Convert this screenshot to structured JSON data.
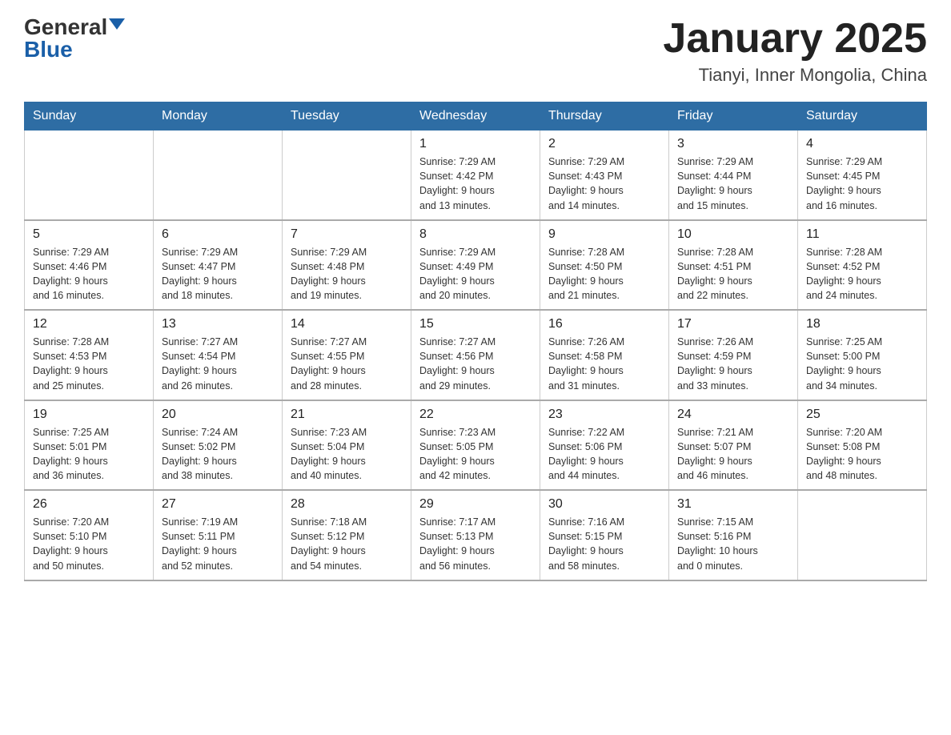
{
  "logo": {
    "general": "General",
    "blue": "Blue"
  },
  "title": "January 2025",
  "location": "Tianyi, Inner Mongolia, China",
  "weekdays": [
    "Sunday",
    "Monday",
    "Tuesday",
    "Wednesday",
    "Thursday",
    "Friday",
    "Saturday"
  ],
  "weeks": [
    [
      {
        "day": "",
        "info": ""
      },
      {
        "day": "",
        "info": ""
      },
      {
        "day": "",
        "info": ""
      },
      {
        "day": "1",
        "info": "Sunrise: 7:29 AM\nSunset: 4:42 PM\nDaylight: 9 hours\nand 13 minutes."
      },
      {
        "day": "2",
        "info": "Sunrise: 7:29 AM\nSunset: 4:43 PM\nDaylight: 9 hours\nand 14 minutes."
      },
      {
        "day": "3",
        "info": "Sunrise: 7:29 AM\nSunset: 4:44 PM\nDaylight: 9 hours\nand 15 minutes."
      },
      {
        "day": "4",
        "info": "Sunrise: 7:29 AM\nSunset: 4:45 PM\nDaylight: 9 hours\nand 16 minutes."
      }
    ],
    [
      {
        "day": "5",
        "info": "Sunrise: 7:29 AM\nSunset: 4:46 PM\nDaylight: 9 hours\nand 16 minutes."
      },
      {
        "day": "6",
        "info": "Sunrise: 7:29 AM\nSunset: 4:47 PM\nDaylight: 9 hours\nand 18 minutes."
      },
      {
        "day": "7",
        "info": "Sunrise: 7:29 AM\nSunset: 4:48 PM\nDaylight: 9 hours\nand 19 minutes."
      },
      {
        "day": "8",
        "info": "Sunrise: 7:29 AM\nSunset: 4:49 PM\nDaylight: 9 hours\nand 20 minutes."
      },
      {
        "day": "9",
        "info": "Sunrise: 7:28 AM\nSunset: 4:50 PM\nDaylight: 9 hours\nand 21 minutes."
      },
      {
        "day": "10",
        "info": "Sunrise: 7:28 AM\nSunset: 4:51 PM\nDaylight: 9 hours\nand 22 minutes."
      },
      {
        "day": "11",
        "info": "Sunrise: 7:28 AM\nSunset: 4:52 PM\nDaylight: 9 hours\nand 24 minutes."
      }
    ],
    [
      {
        "day": "12",
        "info": "Sunrise: 7:28 AM\nSunset: 4:53 PM\nDaylight: 9 hours\nand 25 minutes."
      },
      {
        "day": "13",
        "info": "Sunrise: 7:27 AM\nSunset: 4:54 PM\nDaylight: 9 hours\nand 26 minutes."
      },
      {
        "day": "14",
        "info": "Sunrise: 7:27 AM\nSunset: 4:55 PM\nDaylight: 9 hours\nand 28 minutes."
      },
      {
        "day": "15",
        "info": "Sunrise: 7:27 AM\nSunset: 4:56 PM\nDaylight: 9 hours\nand 29 minutes."
      },
      {
        "day": "16",
        "info": "Sunrise: 7:26 AM\nSunset: 4:58 PM\nDaylight: 9 hours\nand 31 minutes."
      },
      {
        "day": "17",
        "info": "Sunrise: 7:26 AM\nSunset: 4:59 PM\nDaylight: 9 hours\nand 33 minutes."
      },
      {
        "day": "18",
        "info": "Sunrise: 7:25 AM\nSunset: 5:00 PM\nDaylight: 9 hours\nand 34 minutes."
      }
    ],
    [
      {
        "day": "19",
        "info": "Sunrise: 7:25 AM\nSunset: 5:01 PM\nDaylight: 9 hours\nand 36 minutes."
      },
      {
        "day": "20",
        "info": "Sunrise: 7:24 AM\nSunset: 5:02 PM\nDaylight: 9 hours\nand 38 minutes."
      },
      {
        "day": "21",
        "info": "Sunrise: 7:23 AM\nSunset: 5:04 PM\nDaylight: 9 hours\nand 40 minutes."
      },
      {
        "day": "22",
        "info": "Sunrise: 7:23 AM\nSunset: 5:05 PM\nDaylight: 9 hours\nand 42 minutes."
      },
      {
        "day": "23",
        "info": "Sunrise: 7:22 AM\nSunset: 5:06 PM\nDaylight: 9 hours\nand 44 minutes."
      },
      {
        "day": "24",
        "info": "Sunrise: 7:21 AM\nSunset: 5:07 PM\nDaylight: 9 hours\nand 46 minutes."
      },
      {
        "day": "25",
        "info": "Sunrise: 7:20 AM\nSunset: 5:08 PM\nDaylight: 9 hours\nand 48 minutes."
      }
    ],
    [
      {
        "day": "26",
        "info": "Sunrise: 7:20 AM\nSunset: 5:10 PM\nDaylight: 9 hours\nand 50 minutes."
      },
      {
        "day": "27",
        "info": "Sunrise: 7:19 AM\nSunset: 5:11 PM\nDaylight: 9 hours\nand 52 minutes."
      },
      {
        "day": "28",
        "info": "Sunrise: 7:18 AM\nSunset: 5:12 PM\nDaylight: 9 hours\nand 54 minutes."
      },
      {
        "day": "29",
        "info": "Sunrise: 7:17 AM\nSunset: 5:13 PM\nDaylight: 9 hours\nand 56 minutes."
      },
      {
        "day": "30",
        "info": "Sunrise: 7:16 AM\nSunset: 5:15 PM\nDaylight: 9 hours\nand 58 minutes."
      },
      {
        "day": "31",
        "info": "Sunrise: 7:15 AM\nSunset: 5:16 PM\nDaylight: 10 hours\nand 0 minutes."
      },
      {
        "day": "",
        "info": ""
      }
    ]
  ]
}
